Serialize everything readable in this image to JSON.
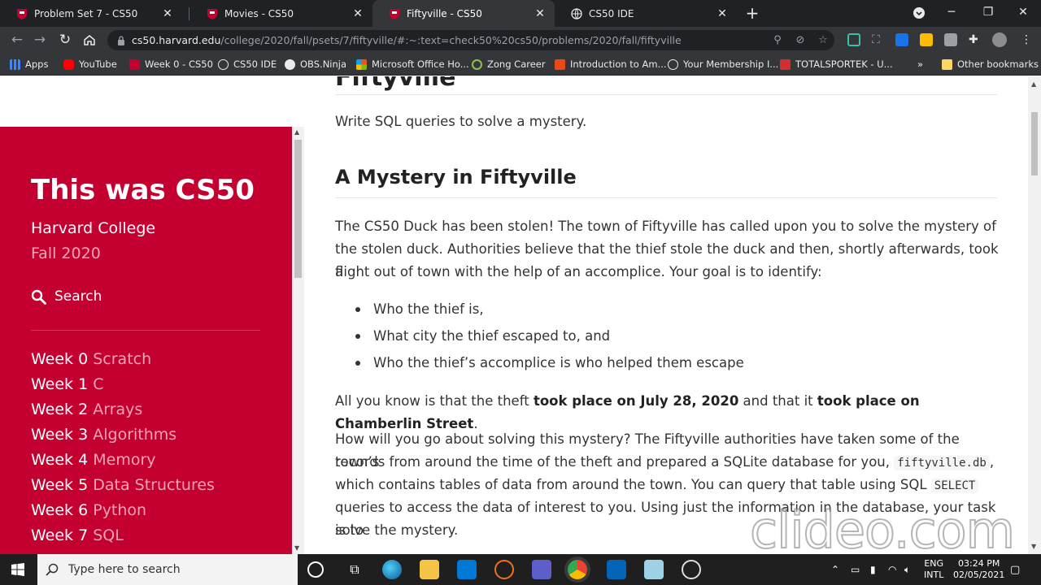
{
  "tabs": [
    {
      "title": "Problem Set 7 - CS50",
      "active": false
    },
    {
      "title": "Movies - CS50",
      "active": false
    },
    {
      "title": "Fiftyville - CS50",
      "active": true
    },
    {
      "title": "CS50 IDE",
      "active": false
    }
  ],
  "omnibox": {
    "host": "cs50.harvard.edu",
    "path": "/college/2020/fall/psets/7/fiftyville/#:~:text=check50%20cs50/problems/2020/fall/fiftyville"
  },
  "bookmarks": [
    "Apps",
    "YouTube",
    "Week 0 - CS50",
    "CS50 IDE",
    "OBS.Ninja",
    "Microsoft Office Ho...",
    "Zong Career",
    "Introduction to Am...",
    "Your Membership I...",
    "TOTALSPORTEK - U...",
    "Other bookmarks"
  ],
  "sidebar": {
    "brand": "This was CS50",
    "college": "Harvard College",
    "term": "Fall 2020",
    "search_label": "Search",
    "weeks": [
      {
        "week": "Week 0",
        "topic": "Scratch"
      },
      {
        "week": "Week 1",
        "topic": "C"
      },
      {
        "week": "Week 2",
        "topic": "Arrays"
      },
      {
        "week": "Week 3",
        "topic": "Algorithms"
      },
      {
        "week": "Week 4",
        "topic": "Memory"
      },
      {
        "week": "Week 5",
        "topic": "Data Structures"
      },
      {
        "week": "Week 6",
        "topic": "Python"
      },
      {
        "week": "Week 7",
        "topic": "SQL"
      }
    ]
  },
  "content": {
    "page_title": "Fiftyville",
    "intro": "Write SQL queries to solve a mystery.",
    "section_title": "A Mystery in Fiftyville",
    "para1_l1": "The CS50 Duck has been stolen! The town of Fiftyville has called upon you to solve the mystery of",
    "para1_l2": "the stolen duck. Authorities believe that the thief stole the duck and then, shortly afterwards, took a",
    "para1_l3": "flight out of town with the help of an accomplice. Your goal is to identify:",
    "bullets": [
      "Who the thief is,",
      "What city the thief escaped to, and",
      "Who the thief’s accomplice is who helped them escape"
    ],
    "para2_a": "All you know is that the theft ",
    "para2_b": "took place on July 28, 2020",
    "para2_c": " and that it ",
    "para2_d": "took place on Chamberlin Street",
    "para2_e": ".",
    "para3_l1": "How will you go about solving this mystery? The Fiftyville authorities have taken some of the town’s",
    "para3_l2a": "records from around the time of the theft and prepared a SQLite database for you, ",
    "para3_code1": "fiftyville.db",
    "para3_l2b": ",",
    "para3_l3a": "which contains tables of data from around the town. You can query that table using SQL ",
    "para3_code2": "SELECT",
    "para3_l4": "queries to access the data of interest to you. Using just the information in the database, your task is to",
    "para3_l5": "solve the mystery."
  },
  "watermark": "clideo.com",
  "taskbar": {
    "search_placeholder": "Type here to search",
    "lang_top": "ENG",
    "lang_bottom": "INTL",
    "time": "03:24 PM",
    "date": "02/05/2021"
  }
}
